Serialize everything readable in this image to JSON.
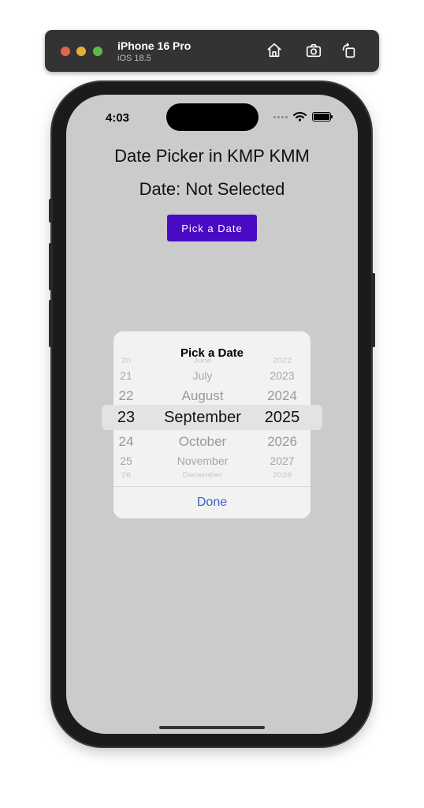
{
  "toolbar": {
    "device_name": "iPhone 16 Pro",
    "os_version": "iOS 18.5",
    "icons": [
      "home-icon",
      "screenshot-icon",
      "rotate-icon"
    ]
  },
  "status_bar": {
    "time": "4:03"
  },
  "app": {
    "title": "Date Picker in KMP KMM",
    "date_status": "Date: Not Selected",
    "pick_button_label": "Pick a Date",
    "accent_color": "#4a0ac3"
  },
  "dialog": {
    "title": "Pick a Date",
    "done_label": "Done",
    "days": [
      "20",
      "21",
      "22",
      "23",
      "24",
      "25",
      "26"
    ],
    "months": [
      "June",
      "July",
      "August",
      "September",
      "October",
      "November",
      "December"
    ],
    "years": [
      "2022",
      "2023",
      "2024",
      "2025",
      "2026",
      "2027",
      "2028"
    ],
    "selected": {
      "day": "23",
      "month": "September",
      "year": "2025"
    }
  }
}
